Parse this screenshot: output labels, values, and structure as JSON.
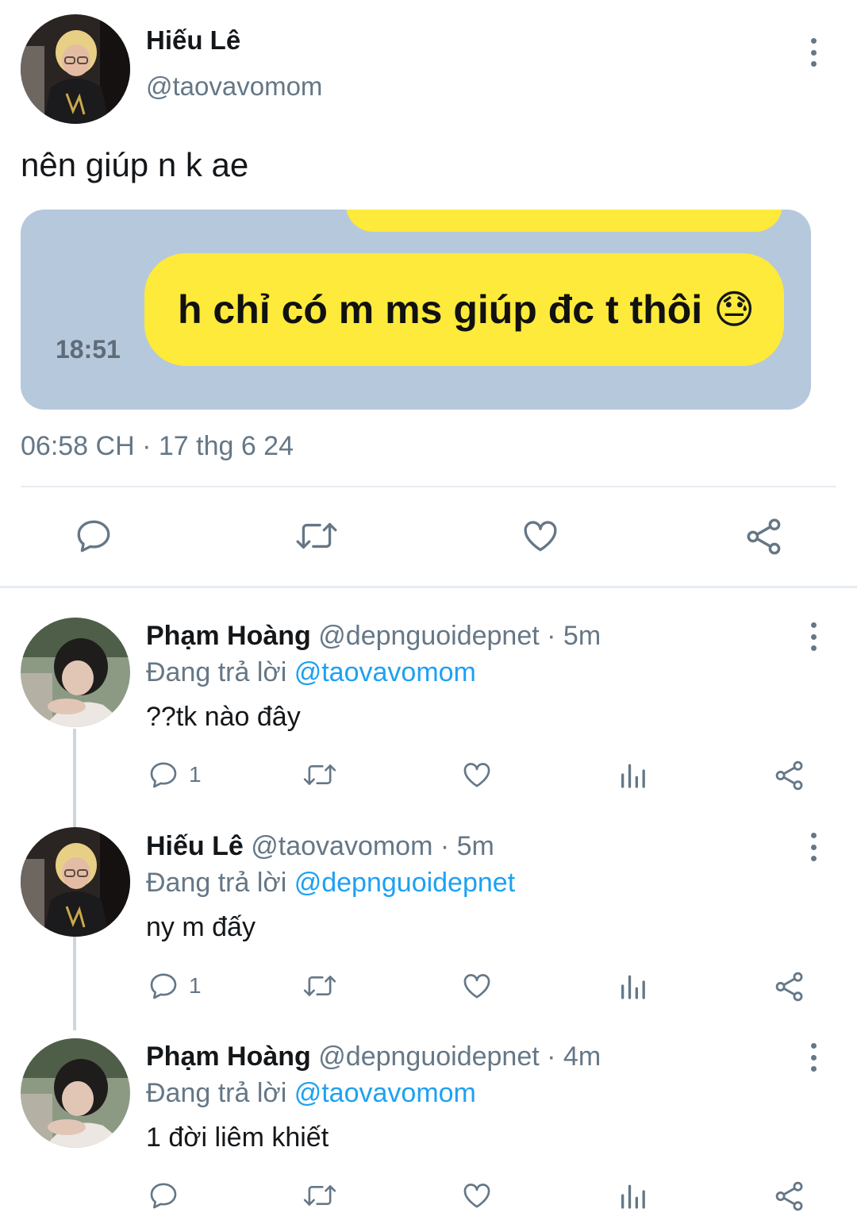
{
  "main_tweet": {
    "display_name": "Hiếu Lê",
    "handle": "@taovavomom",
    "text": "nên giúp n k ae",
    "image": {
      "bubble_text": "h chỉ có m ms giúp đc t thôi",
      "emoji": "😓",
      "time": "18:51",
      "bg_color": "#b6c8dc",
      "bubble_color": "#fdea3a"
    },
    "timestamp": "06:58 CH · 17 thg 6 24",
    "actions": [
      "reply-icon",
      "retweet-icon",
      "like-icon",
      "share-icon"
    ]
  },
  "replies": [
    {
      "display_name": "Phạm Hoàng",
      "handle": "@depnguoidepnet",
      "time": "· 5m",
      "replying_prefix": "Đang trả lời",
      "replying_to": "@taovavomom",
      "text": "??tk nào đây",
      "reply_count": "1"
    },
    {
      "display_name": "Hiếu Lê",
      "handle": "@taovavomom",
      "time": "· 5m",
      "replying_prefix": "Đang trả lời",
      "replying_to": "@depnguoidepnet",
      "text": "ny m đấy",
      "reply_count": "1"
    },
    {
      "display_name": "Phạm Hoàng",
      "handle": "@depnguoidepnet",
      "time": "· 4m",
      "replying_prefix": "Đang trả lời",
      "replying_to": "@taovavomom",
      "text": "1 đời liêm khiết",
      "reply_count": ""
    }
  ],
  "colors": {
    "accent": "#1da1f2",
    "muted": "#657786",
    "divider": "#e6ecf0"
  }
}
